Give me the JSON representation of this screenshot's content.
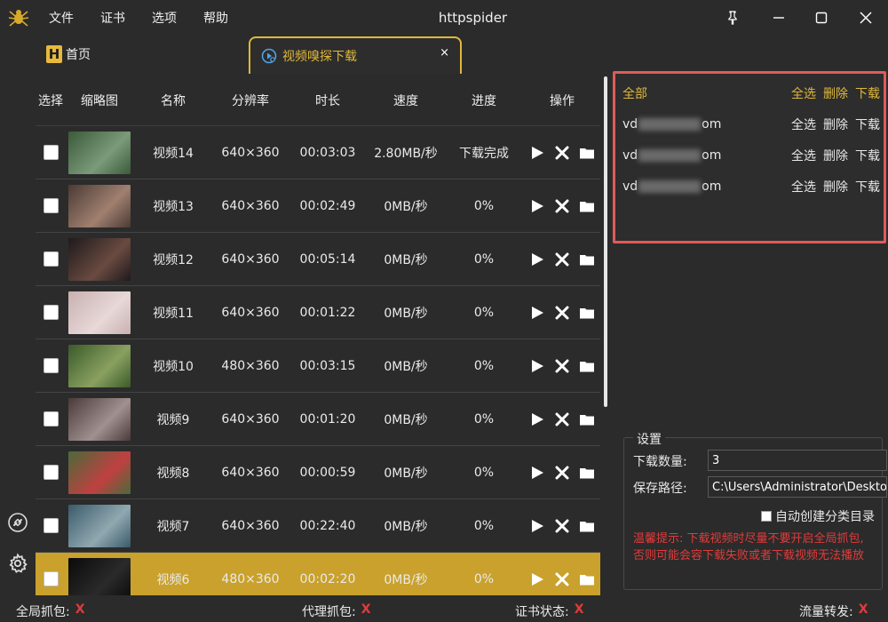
{
  "window": {
    "title": "httpspider",
    "menu": [
      "文件",
      "证书",
      "选项",
      "帮助"
    ],
    "controls": [
      "pin-icon",
      "minimize-icon",
      "maximize-icon",
      "close-icon"
    ]
  },
  "tabs": {
    "home": {
      "badge": "H",
      "label": "首页"
    },
    "active": {
      "label": "视频嗅探下载",
      "close": "×"
    }
  },
  "table": {
    "headers": [
      "选择",
      "缩略图",
      "名称",
      "分辨率",
      "时长",
      "速度",
      "进度",
      "操作"
    ],
    "rows": [
      {
        "name": "视频14",
        "resolution": "640×360",
        "duration": "00:03:03",
        "speed": "2.80MB/秒",
        "progress": "下载完成"
      },
      {
        "name": "视频13",
        "resolution": "640×360",
        "duration": "00:02:49",
        "speed": "0MB/秒",
        "progress": "0%"
      },
      {
        "name": "视频12",
        "resolution": "640×360",
        "duration": "00:05:14",
        "speed": "0MB/秒",
        "progress": "0%"
      },
      {
        "name": "视频11",
        "resolution": "640×360",
        "duration": "00:01:22",
        "speed": "0MB/秒",
        "progress": "0%"
      },
      {
        "name": "视频10",
        "resolution": "480×360",
        "duration": "00:03:15",
        "speed": "0MB/秒",
        "progress": "0%"
      },
      {
        "name": "视频9",
        "resolution": "640×360",
        "duration": "00:01:20",
        "speed": "0MB/秒",
        "progress": "0%"
      },
      {
        "name": "视频8",
        "resolution": "640×360",
        "duration": "00:00:59",
        "speed": "0MB/秒",
        "progress": "0%"
      },
      {
        "name": "视频7",
        "resolution": "640×360",
        "duration": "00:22:40",
        "speed": "0MB/秒",
        "progress": "0%"
      },
      {
        "name": "视频6",
        "resolution": "480×360",
        "duration": "00:02:20",
        "speed": "0MB/秒",
        "progress": "0%"
      }
    ]
  },
  "hosts": {
    "all_label": "全部",
    "actions": {
      "select_all": "全选",
      "delete": "删除",
      "download": "下载"
    },
    "items": [
      {
        "prefix": "vd",
        "suffix": "om"
      },
      {
        "prefix": "vd",
        "suffix": "om"
      },
      {
        "prefix": "vd",
        "suffix": "om"
      }
    ]
  },
  "settings": {
    "title": "设置",
    "download_count_label": "下载数量:",
    "download_count_value": "3",
    "save_path_label": "保存路径:",
    "save_path_value": "C:\\Users\\Administrator\\Desktop\\",
    "auto_create_label": "自动创建分类目录",
    "warning": "温馨提示: 下载视频时尽量不要开启全局抓包, 否则可能会容下载失败或者下载视频无法播放"
  },
  "status": {
    "global_capture": "全局抓包:",
    "proxy_capture": "代理抓包:",
    "cert_status": "证书状态:",
    "traffic_forward": "流量转发:",
    "off_mark": "X"
  },
  "colors": {
    "accent": "#e0b83a",
    "selected_row": "#c9a12c",
    "highlight_border": "#e05a5a",
    "warning": "#e23b3b"
  }
}
